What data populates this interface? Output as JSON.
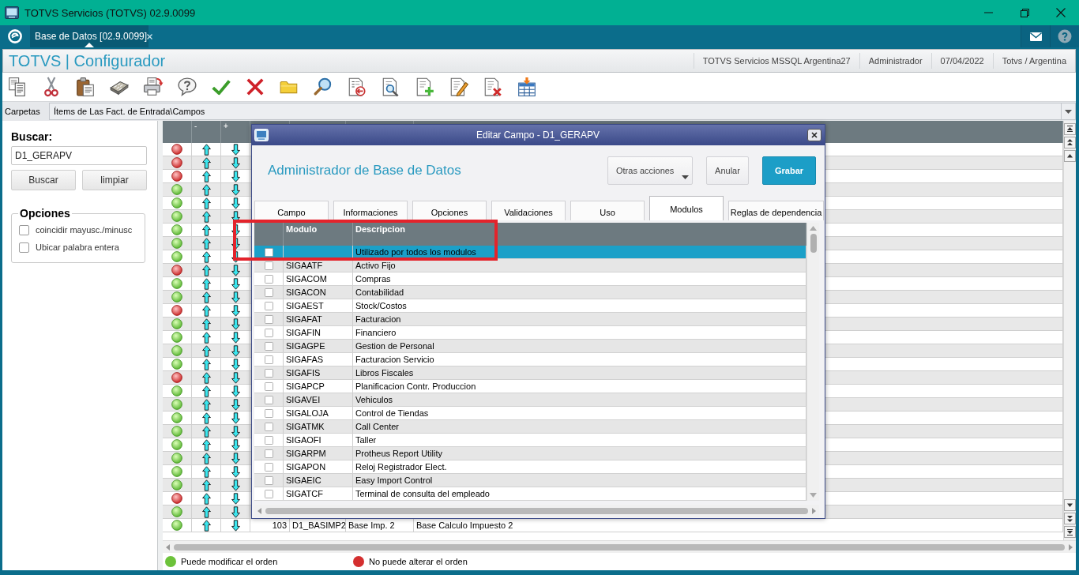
{
  "window": {
    "title": "TOTVS Servicios (TOTVS) 02.9.0099"
  },
  "app_tabs": [
    {
      "label": "Base de Datos [02.9.0099]",
      "selected": true
    }
  ],
  "header": {
    "title": "TOTVS | Configurador",
    "info": [
      "TOTVS Servicios MSSQL Argentina27",
      "Administrador",
      "07/04/2022",
      "Totvs / Argentina"
    ]
  },
  "folder_bar": {
    "label": "Carpetas",
    "value": "Ítems de Las Fact. de Entrada\\Campos"
  },
  "search_panel": {
    "title": "Buscar:",
    "value": "D1_GERAPV",
    "buttons": [
      "Buscar",
      "limpiar"
    ],
    "options_title": "Opciones",
    "options": [
      {
        "label": "coincidir mayusc./minusc",
        "checked": false
      },
      {
        "label": "Ubicar palabra entera",
        "checked": false
      }
    ]
  },
  "fields_table": {
    "columns": [
      "-",
      "+"
    ],
    "rows": [
      {
        "movable": false
      },
      {
        "movable": false
      },
      {
        "movable": false
      },
      {
        "movable": true
      },
      {
        "movable": true
      },
      {
        "movable": true
      },
      {
        "movable": true
      },
      {
        "movable": true
      },
      {
        "movable": true
      },
      {
        "movable": false
      },
      {
        "movable": true
      },
      {
        "movable": true
      },
      {
        "movable": false
      },
      {
        "movable": true
      },
      {
        "movable": true
      },
      {
        "movable": true
      },
      {
        "movable": true
      },
      {
        "movable": false
      },
      {
        "movable": true
      },
      {
        "movable": true
      },
      {
        "movable": true
      },
      {
        "movable": true
      },
      {
        "movable": true
      },
      {
        "movable": true
      },
      {
        "movable": true
      },
      {
        "movable": true
      },
      {
        "movable": false
      },
      {
        "movable": true
      },
      {
        "movable": true,
        "cells": [
          "103",
          "D1_BASIMP2",
          "Base Imp. 2",
          "Base Calculo Impuesto 2"
        ]
      }
    ]
  },
  "legend": [
    {
      "label": "Puede modificar el orden",
      "color": "#6cc23a"
    },
    {
      "label": "No puede alterar el orden",
      "color": "#d42f2f"
    }
  ],
  "dialog": {
    "title": "Editar Campo - D1_GERAPV",
    "heading": "Administrador de Base de Datos",
    "buttons": [
      {
        "label": "Otras acciones",
        "kind": "menu"
      },
      {
        "label": "Anular",
        "kind": "plain"
      },
      {
        "label": "Grabar",
        "kind": "primary"
      }
    ],
    "tabs": [
      {
        "label": "Campo",
        "selected": false
      },
      {
        "label": "Informaciones",
        "selected": false
      },
      {
        "label": "Opciones",
        "selected": false
      },
      {
        "label": "Validaciones",
        "selected": false
      },
      {
        "label": "Uso",
        "selected": false
      },
      {
        "label": "Modulos",
        "selected": true
      },
      {
        "label": "Reglas de dependencia",
        "selected": false
      }
    ],
    "modules_table": {
      "columns": [
        "Modulo",
        "Descripcion"
      ],
      "rows": [
        {
          "checked": false,
          "selected": true,
          "description": "Utilizado por todos los modulos"
        },
        {
          "checked": false,
          "selected": false,
          "module": "SIGAATF",
          "description": "Activo Fijo"
        },
        {
          "checked": false,
          "selected": false,
          "module": "SIGACOM",
          "description": "Compras"
        },
        {
          "checked": false,
          "selected": false,
          "module": "SIGACON",
          "description": "Contabilidad"
        },
        {
          "checked": false,
          "selected": false,
          "module": "SIGAEST",
          "description": "Stock/Costos"
        },
        {
          "checked": false,
          "selected": false,
          "module": "SIGAFAT",
          "description": "Facturacion"
        },
        {
          "checked": false,
          "selected": false,
          "module": "SIGAFIN",
          "description": "Financiero"
        },
        {
          "checked": false,
          "selected": false,
          "module": "SIGAGPE",
          "description": "Gestion de Personal"
        },
        {
          "checked": false,
          "selected": false,
          "module": "SIGAFAS",
          "description": "Facturacion Servicio"
        },
        {
          "checked": false,
          "selected": false,
          "module": "SIGAFIS",
          "description": "Libros Fiscales"
        },
        {
          "checked": false,
          "selected": false,
          "module": "SIGAPCP",
          "description": "Planificacion Contr. Produccion"
        },
        {
          "checked": false,
          "selected": false,
          "module": "SIGAVEI",
          "description": "Vehiculos"
        },
        {
          "checked": false,
          "selected": false,
          "module": "SIGALOJA",
          "description": "Control de Tiendas"
        },
        {
          "checked": false,
          "selected": false,
          "module": "SIGATMK",
          "description": "Call Center"
        },
        {
          "checked": false,
          "selected": false,
          "module": "SIGAOFI",
          "description": "Taller"
        },
        {
          "checked": false,
          "selected": false,
          "module": "SIGARPM",
          "description": "Protheus Report Utility"
        },
        {
          "checked": false,
          "selected": false,
          "module": "SIGAPON",
          "description": "Reloj Registrador Elect."
        },
        {
          "checked": false,
          "selected": false,
          "module": "SIGAEIC",
          "description": "Easy Import Control"
        },
        {
          "checked": false,
          "selected": false,
          "module": "SIGATCF",
          "description": "Terminal de consulta del empleado"
        }
      ]
    }
  }
}
